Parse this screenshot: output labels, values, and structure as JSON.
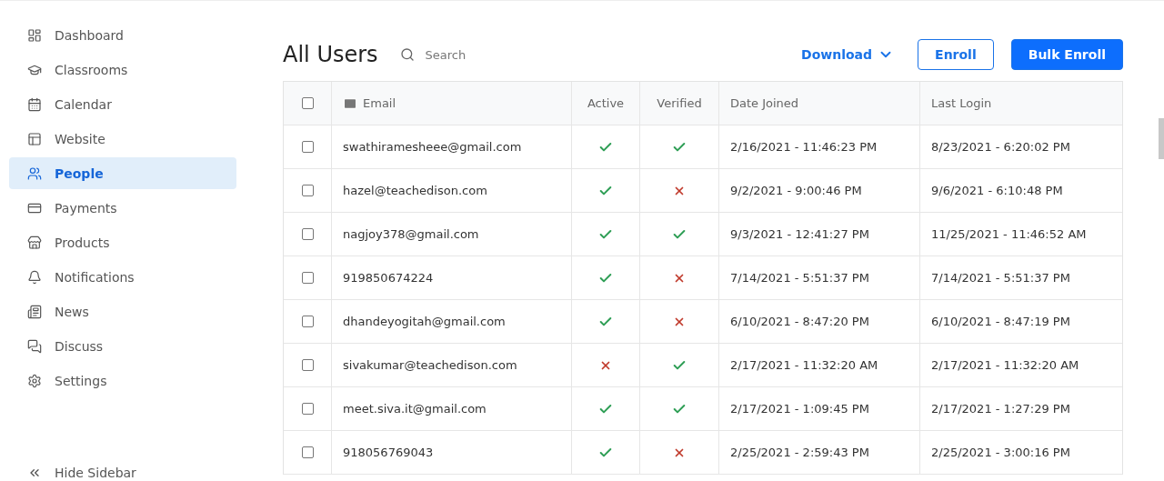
{
  "sidebar": {
    "items": [
      {
        "label": "Dashboard",
        "selected": false
      },
      {
        "label": "Classrooms",
        "selected": false
      },
      {
        "label": "Calendar",
        "selected": false
      },
      {
        "label": "Website",
        "selected": false
      },
      {
        "label": "People",
        "selected": true
      },
      {
        "label": "Payments",
        "selected": false
      },
      {
        "label": "Products",
        "selected": false
      },
      {
        "label": "Notifications",
        "selected": false
      },
      {
        "label": "News",
        "selected": false
      },
      {
        "label": "Discuss",
        "selected": false
      },
      {
        "label": "Settings",
        "selected": false
      }
    ],
    "hide_button": "Hide Sidebar"
  },
  "header": {
    "title": "All Users",
    "search": {
      "placeholder": "Search"
    },
    "download": "Download",
    "enroll": "Enroll",
    "bulk_enroll": "Bulk Enroll"
  },
  "table": {
    "select_all_checked": false,
    "columns": [
      "Email",
      "Active",
      "Verified",
      "Date Joined",
      "Last Login"
    ],
    "rows": [
      {
        "checked": false,
        "email": "swathiramesheee@gmail.com",
        "active": true,
        "verified": true,
        "date_joined": "2/16/2021 - 11:46:23 PM",
        "last_login": "8/23/2021 - 6:20:02 PM"
      },
      {
        "checked": false,
        "email": "hazel@teachedison.com",
        "active": true,
        "verified": false,
        "date_joined": "9/2/2021 - 9:00:46 PM",
        "last_login": "9/6/2021 - 6:10:48 PM"
      },
      {
        "checked": false,
        "email": "nagjoy378@gmail.com",
        "active": true,
        "verified": true,
        "date_joined": "9/3/2021 - 12:41:27 PM",
        "last_login": "11/25/2021 - 11:46:52 AM"
      },
      {
        "checked": false,
        "email": "919850674224",
        "active": true,
        "verified": false,
        "date_joined": "7/14/2021 - 5:51:37 PM",
        "last_login": "7/14/2021 - 5:51:37 PM"
      },
      {
        "checked": false,
        "email": "dhandeyogitah@gmail.com",
        "active": true,
        "verified": false,
        "date_joined": "6/10/2021 - 8:47:20 PM",
        "last_login": "6/10/2021 - 8:47:19 PM"
      },
      {
        "checked": false,
        "email": "sivakumar@teachedison.com",
        "active": false,
        "verified": true,
        "date_joined": "2/17/2021 - 11:32:20 AM",
        "last_login": "2/17/2021 - 11:32:20 AM"
      },
      {
        "checked": false,
        "email": "meet.siva.it@gmail.com",
        "active": true,
        "verified": true,
        "date_joined": "2/17/2021 - 1:09:45 PM",
        "last_login": "2/17/2021 - 1:27:29 PM"
      },
      {
        "checked": false,
        "email": "918056769043",
        "active": true,
        "verified": false,
        "date_joined": "2/25/2021 - 2:59:43 PM",
        "last_login": "2/25/2021 - 3:00:16 PM"
      }
    ]
  }
}
